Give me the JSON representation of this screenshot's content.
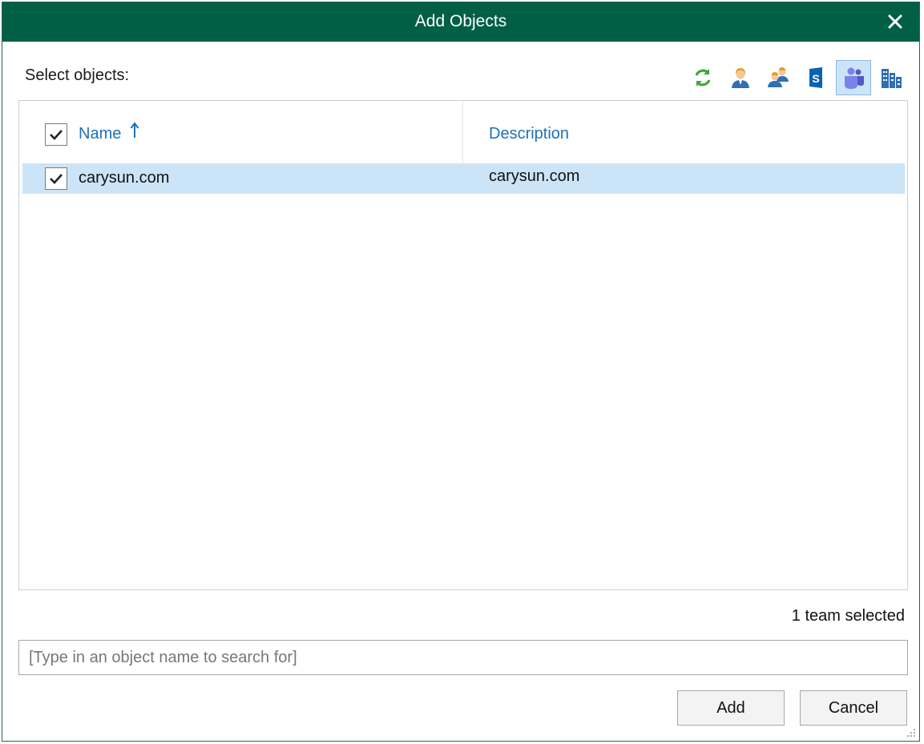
{
  "dialog": {
    "title": "Add Objects",
    "select_label": "Select objects:",
    "accent_color": "#005f45",
    "selection_color": "#cce4f7",
    "link_color": "#1d71b8"
  },
  "toolbar": {
    "buttons": [
      {
        "icon": "refresh-icon",
        "active": false
      },
      {
        "icon": "user-icon",
        "active": false
      },
      {
        "icon": "group-icon",
        "active": false
      },
      {
        "icon": "sharepoint-icon",
        "active": false
      },
      {
        "icon": "teams-icon",
        "active": true
      },
      {
        "icon": "organization-icon",
        "active": false
      }
    ]
  },
  "table": {
    "columns": [
      {
        "label": "Name",
        "sort": "ascending"
      },
      {
        "label": "Description"
      }
    ],
    "header_checked": true,
    "rows": [
      {
        "name": "carysun.com",
        "description": "carysun.com",
        "checked": true,
        "selected": true
      }
    ]
  },
  "status": {
    "text": "1 team selected"
  },
  "search": {
    "placeholder": "[Type in an object name to search for]",
    "value": ""
  },
  "buttons": {
    "add_label": "Add",
    "cancel_label": "Cancel"
  }
}
